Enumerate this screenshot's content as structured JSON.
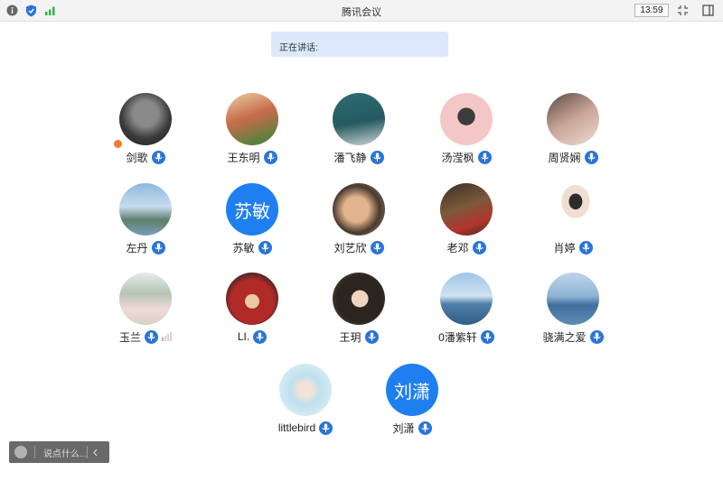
{
  "window": {
    "title": "腾讯会议",
    "clock": "13:59"
  },
  "speaking": {
    "label": "正在讲话:"
  },
  "participants": [
    {
      "name": "剑歌",
      "avatar": "photo",
      "host": true
    },
    {
      "name": "王东明",
      "avatar": "photo"
    },
    {
      "name": "潘飞静",
      "avatar": "photo"
    },
    {
      "name": "汤滢枫",
      "avatar": "photo"
    },
    {
      "name": "周贤娴",
      "avatar": "photo"
    },
    {
      "name": "左丹",
      "avatar": "photo"
    },
    {
      "name": "苏敏",
      "avatar": "text",
      "avatar_text": "苏敏"
    },
    {
      "name": "刘艺欣",
      "avatar": "photo"
    },
    {
      "name": "老邓",
      "avatar": "photo"
    },
    {
      "name": "肖婷",
      "avatar": "photo"
    },
    {
      "name": "玉兰",
      "avatar": "photo",
      "signal": true
    },
    {
      "name": "LI.",
      "avatar": "photo"
    },
    {
      "name": "王玥",
      "avatar": "photo"
    },
    {
      "name": "0潘紫轩",
      "avatar": "photo"
    },
    {
      "name": "骁满之爱",
      "avatar": "photo"
    },
    {
      "name": "littlebird",
      "avatar": "photo"
    },
    {
      "name": "刘潇",
      "avatar": "text",
      "avatar_text": "刘潇"
    }
  ],
  "chat": {
    "placeholder": "说点什么..."
  },
  "colors": {
    "accent": "#1f7ff0",
    "mic": "#2a74d8",
    "speaking_bg": "#dce8fb"
  },
  "icons": [
    "info-icon",
    "shield-icon",
    "signal-icon",
    "fullscreen-icon",
    "sidebar-toggle-icon",
    "microphone-icon",
    "emoji-icon",
    "collapse-arrow-icon"
  ]
}
